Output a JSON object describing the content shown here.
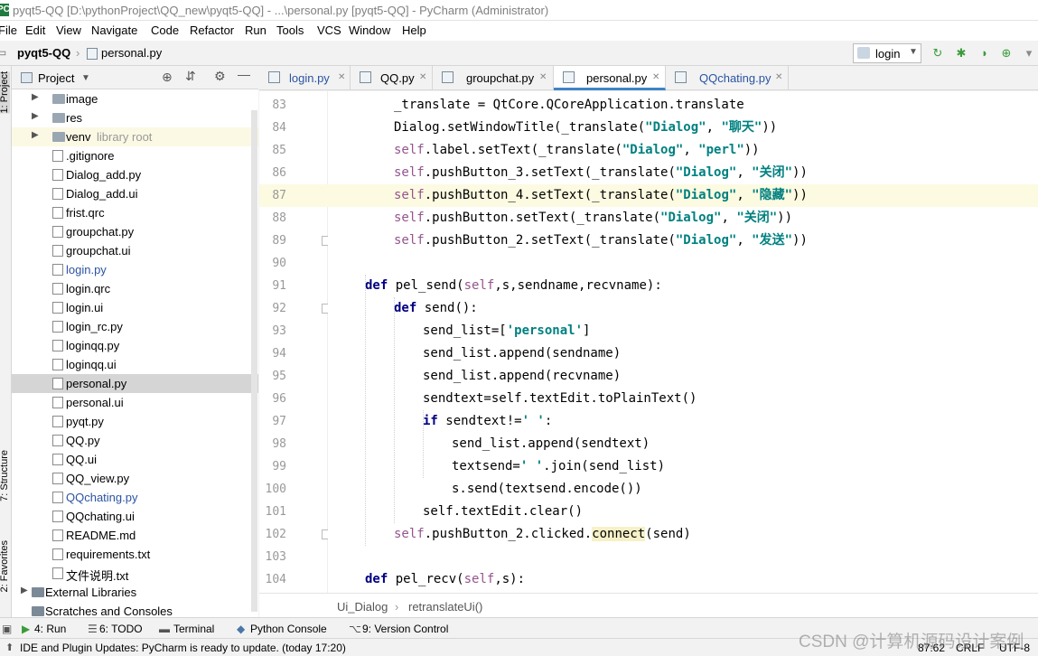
{
  "window": {
    "title": "pyqt5-QQ [D:\\pythonProject\\QQ_new\\pyqt5-QQ] - ...\\personal.py [pyqt5-QQ] - PyCharm (Administrator)"
  },
  "menu": [
    "File",
    "Edit",
    "View",
    "Navigate",
    "Code",
    "Refactor",
    "Run",
    "Tools",
    "VCS",
    "Window",
    "Help"
  ],
  "breadcrumb": {
    "project": "pyqt5-QQ",
    "file": "personal.py"
  },
  "run_config": {
    "value": "login"
  },
  "left_tabs": {
    "project": "1: Project",
    "structure": "7: Structure",
    "favorites": "2: Favorites"
  },
  "project_panel": {
    "title": "Project"
  },
  "tree": [
    {
      "label": "image",
      "kind": "folder"
    },
    {
      "label": "res",
      "kind": "folder"
    },
    {
      "label": "venv",
      "suffix": "library root",
      "kind": "folder"
    },
    {
      "label": ".gitignore",
      "kind": "file"
    },
    {
      "label": "Dialog_add.py",
      "kind": "file"
    },
    {
      "label": "Dialog_add.ui",
      "kind": "file"
    },
    {
      "label": "frist.qrc",
      "kind": "file"
    },
    {
      "label": "groupchat.py",
      "kind": "file"
    },
    {
      "label": "groupchat.ui",
      "kind": "file"
    },
    {
      "label": "login.py",
      "kind": "file",
      "color": "#2b53a3"
    },
    {
      "label": "login.qrc",
      "kind": "file"
    },
    {
      "label": "login.ui",
      "kind": "file"
    },
    {
      "label": "login_rc.py",
      "kind": "file"
    },
    {
      "label": "loginqq.py",
      "kind": "file"
    },
    {
      "label": "loginqq.ui",
      "kind": "file"
    },
    {
      "label": "personal.py",
      "kind": "file",
      "selected": true
    },
    {
      "label": "personal.ui",
      "kind": "file"
    },
    {
      "label": "pyqt.py",
      "kind": "file"
    },
    {
      "label": "QQ.py",
      "kind": "file"
    },
    {
      "label": "QQ.ui",
      "kind": "file"
    },
    {
      "label": "QQ_view.py",
      "kind": "file"
    },
    {
      "label": "QQchating.py",
      "kind": "file",
      "color": "#2b53a3"
    },
    {
      "label": "QQchating.ui",
      "kind": "file"
    },
    {
      "label": "README.md",
      "kind": "file"
    },
    {
      "label": "requirements.txt",
      "kind": "file"
    },
    {
      "label": "文件说明.txt",
      "kind": "file"
    },
    {
      "label": "External Libraries",
      "kind": "root"
    },
    {
      "label": "Scratches and Consoles",
      "kind": "root"
    }
  ],
  "tabs": [
    {
      "label": "login.py",
      "color": "#2b53a3"
    },
    {
      "label": "QQ.py"
    },
    {
      "label": "groupchat.py"
    },
    {
      "label": "personal.py",
      "active": true
    },
    {
      "label": "QQchating.py",
      "color": "#2b53a3"
    }
  ],
  "code": {
    "lines": [
      {
        "n": "83",
        "indent": 2,
        "html": "_translate = QtCore.QCoreApplication.translate"
      },
      {
        "n": "84",
        "indent": 2,
        "html": "Dialog.setWindowTitle(_translate(<span class='str'>\"Dialog\"</span>, <span class='str'>\"聊天\"</span>))"
      },
      {
        "n": "85",
        "indent": 2,
        "html": "<span class='self'>self</span>.label.setText(_translate(<span class='str'>\"Dialog\"</span>, <span class='str'>\"perl\"</span>))"
      },
      {
        "n": "86",
        "indent": 2,
        "html": "<span class='self'>self</span>.pushButton_3.setText(_translate(<span class='str'>\"Dialog\"</span>, <span class='str'>\"关闭\"</span>))"
      },
      {
        "n": "87",
        "indent": 2,
        "hl": true,
        "html": "<span class='self'>self</span>.pushButton_4.setText(_translate(<span class='str'>\"Dialog\"</span>, <span class='str'>\"隐藏\"</span>))"
      },
      {
        "n": "88",
        "indent": 2,
        "html": "<span class='self'>self</span>.pushButton.setText(_translate(<span class='str'>\"Dialog\"</span>, <span class='str'>\"关闭\"</span>))"
      },
      {
        "n": "89",
        "indent": 2,
        "html": "<span class='self'>self</span>.pushButton_2.setText(_translate(<span class='str'>\"Dialog\"</span>, <span class='str'>\"发送\"</span>))"
      },
      {
        "n": "90",
        "indent": 0,
        "html": ""
      },
      {
        "n": "91",
        "indent": 1,
        "html": "<span class='kw'>def</span> pel_send(<span class='self'>self</span>,s,sendname,recvname):"
      },
      {
        "n": "92",
        "indent": 2,
        "html": "<span class='kw'>def</span> send():"
      },
      {
        "n": "93",
        "indent": 3,
        "html": "send_list=[<span class='str'>'personal'</span>]"
      },
      {
        "n": "94",
        "indent": 3,
        "html": "send_list.append(sendname)"
      },
      {
        "n": "95",
        "indent": 3,
        "html": "send_list.append(recvname)"
      },
      {
        "n": "96",
        "indent": 3,
        "html": "sendtext=self.textEdit.toPlainText()"
      },
      {
        "n": "97",
        "indent": 3,
        "html": "<span class='kw'>if</span> sendtext!=<span class='str'>' '</span>:"
      },
      {
        "n": "98",
        "indent": 4,
        "html": "send_list.append(sendtext)"
      },
      {
        "n": "99",
        "indent": 4,
        "html": "textsend=<span class='str'>' '</span>.join(send_list)"
      },
      {
        "n": "100",
        "indent": 4,
        "html": "s.send(textsend.encode())"
      },
      {
        "n": "101",
        "indent": 3,
        "html": "self.textEdit.clear()"
      },
      {
        "n": "102",
        "indent": 2,
        "html": "<span class='self'>self</span>.pushButton_2.clicked.<span style='background:#f7f1c8'>connect</span>(send)"
      },
      {
        "n": "103",
        "indent": 0,
        "html": ""
      },
      {
        "n": "104",
        "indent": 1,
        "html": "<span class='kw'>def</span> pel_recv(<span class='self'>self</span>,s):"
      }
    ]
  },
  "code_breadcrumb": {
    "class": "Ui_Dialog",
    "method": "retranslateUi()"
  },
  "tool_windows": {
    "run": "4: Run",
    "todo": "6: TODO",
    "terminal": "Terminal",
    "python_console": "Python Console",
    "version_control": "9: Version Control"
  },
  "status": {
    "message": "IDE and Plugin Updates: PyCharm is ready to update. (today 17:20)",
    "position": "87:62",
    "line_sep": "CRLF",
    "encoding": "UTF-8"
  },
  "watermark": "CSDN @计算机源码设计案例"
}
